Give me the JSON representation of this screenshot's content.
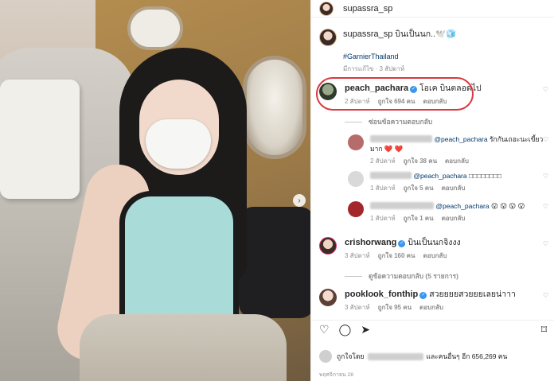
{
  "post": {
    "owner": "supassra_sp",
    "caption_user": "supassra_sp",
    "caption_text": "บินเป็นนก..🕊️🧊",
    "hashtag": "#GarnierThailand",
    "caption_meta": "มีการแก้ไข · 3 สัปดาห์",
    "next_icon": "›"
  },
  "comments": [
    {
      "user": "peach_pachara",
      "text": "โอเค บินตลอดไป",
      "time": "2 สัปดาห์",
      "likes": "ถูกใจ 694 คน",
      "reply": "ตอบกลับ",
      "toggle": "ซ่อนข้อความตอบกลับ",
      "replies": [
        {
          "mention": "@peach_pachara",
          "text": "รักกันเถอะนะเขี้ยวมาก ❤️ ❤️",
          "time": "2 สัปดาห์",
          "likes": "ถูกใจ 38 คน",
          "reply": "ตอบกลับ"
        },
        {
          "mention": "@peach_pachara",
          "text": "□□□□□□□□",
          "time": "1 สัปดาห์",
          "likes": "ถูกใจ 5 คน",
          "reply": "ตอบกลับ"
        },
        {
          "mention": "@peach_pachara",
          "text": "😮 😮 😮 😮",
          "time": "1 สัปดาห์",
          "likes": "ถูกใจ 1 คน",
          "reply": "ตอบกลับ"
        }
      ]
    },
    {
      "user": "crishorwang",
      "text": "บินเป็นนกจิงงง",
      "time": "3 สัปดาห์",
      "likes": "ถูกใจ 160 คน",
      "reply": "ตอบกลับ",
      "toggle": "ดูข้อความตอบกลับ (5 รายการ)"
    },
    {
      "user": "pooklook_fonthip",
      "text": "สวยยยยสวยยยเลยน่าาา",
      "time": "3 สัปดาห์",
      "likes": "ถูกใจ 95 คน",
      "reply": "ตอบกลับ"
    }
  ],
  "actions": {
    "like": "♡",
    "comment": "◯",
    "share": "➤",
    "save": "⌑"
  },
  "likes_line": {
    "prefix": "ถูกใจโดย",
    "suffix": "และคนอื่นๆ อีก 656,269 คน"
  },
  "date": "พฤศจิกายน 28",
  "colors": {
    "highlight": "#d9393e",
    "verified": "#3897f0",
    "hashtag": "#00376b",
    "muted": "#8e8e8e"
  }
}
